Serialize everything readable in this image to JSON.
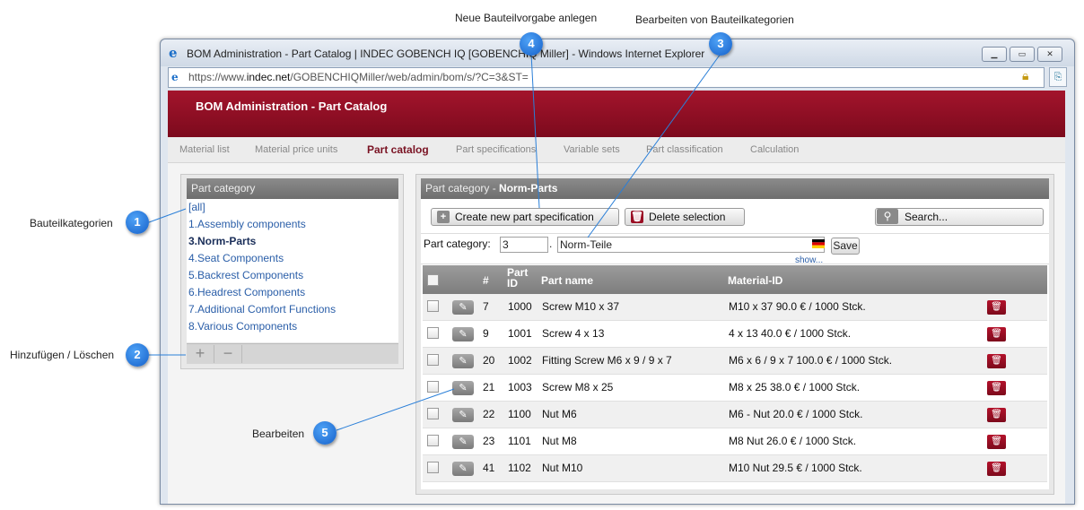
{
  "browser": {
    "window_title": "BOM Administration - Part Catalog | INDEC GOBENCH IQ [GOBENCHIQ Miller] - Windows Internet Explorer",
    "url_prefix": "https://www.",
    "url_domain": "indec.net",
    "url_path": "/GOBENCHIQMiller/web/admin/bom/s/?C=3&ST=",
    "ie_icon": "internet-explorer-icon",
    "lock_icon": "lock-icon"
  },
  "app": {
    "banner_title": "BOM Administration - Part Catalog",
    "nav": [
      {
        "label": "Material list"
      },
      {
        "label": "Material price units"
      },
      {
        "label": "Part catalog"
      },
      {
        "label": "Part specifications"
      },
      {
        "label": "Variable sets"
      },
      {
        "label": "Part classification"
      },
      {
        "label": "Calculation"
      }
    ],
    "active_nav": "Part catalog"
  },
  "left_panel": {
    "title": "Part category",
    "items": [
      {
        "label": "[all]"
      },
      {
        "label": "1.Assembly components"
      },
      {
        "label": "3.Norm-Parts"
      },
      {
        "label": "4.Seat Components"
      },
      {
        "label": "5.Backrest Components"
      },
      {
        "label": "6.Headrest Components"
      },
      {
        "label": "7.Additional Comfort Functions"
      },
      {
        "label": "8.Various Components"
      }
    ],
    "selected": "3.Norm-Parts",
    "add_label": "+",
    "remove_label": "−"
  },
  "right_panel": {
    "title_prefix": "Part category - ",
    "title_bold": "Norm-Parts",
    "create_button": "Create new part specification",
    "delete_button": "Delete selection",
    "search_placeholder": "Search...",
    "category_label": "Part category:",
    "category_id": "3",
    "category_sep": ".",
    "category_name": "Norm-Teile",
    "save_button": "Save",
    "show_link": "show...",
    "table": {
      "headers": [
        "#",
        "Part ID",
        "Part name",
        "Material-ID"
      ],
      "header_part_id_line1": "Part",
      "header_part_id_line2": "ID",
      "rows": [
        {
          "num": "7",
          "part_id": "1000",
          "name": "Screw M10 x 37",
          "material": "M10 x 37 90.0 € / 1000 Stck."
        },
        {
          "num": "9",
          "part_id": "1001",
          "name": "Screw 4 x 13",
          "material": "4 x 13 40.0 € / 1000 Stck."
        },
        {
          "num": "20",
          "part_id": "1002",
          "name": "Fitting Screw M6 x 9 / 9 x 7",
          "material": "M6 x 6 / 9 x 7 100.0 € / 1000 Stck."
        },
        {
          "num": "21",
          "part_id": "1003",
          "name": "Screw M8 x 25",
          "material": "M8 x 25 38.0 € / 1000 Stck."
        },
        {
          "num": "22",
          "part_id": "1100",
          "name": "Nut M6",
          "material": "M6 - Nut 20.0 € / 1000 Stck."
        },
        {
          "num": "23",
          "part_id": "1101",
          "name": "Nut M8",
          "material": "M8 Nut 26.0 € / 1000 Stck."
        },
        {
          "num": "41",
          "part_id": "1102",
          "name": "Nut M10",
          "material": "M10 Nut 29.5 € / 1000 Stck."
        }
      ]
    }
  },
  "callouts": [
    {
      "number": "1",
      "label": "Bauteilkategorien"
    },
    {
      "number": "2",
      "label": "Hinzufügen / Löschen"
    },
    {
      "number": "3",
      "label": "Bearbeiten von Bauteilkategorien"
    },
    {
      "number": "4",
      "label": "Neue Bauteilvorgabe anlegen"
    },
    {
      "number": "5",
      "label": "Bearbeiten"
    }
  ],
  "colors": {
    "banner": "#8f0f25",
    "callout": "#1f6fd8",
    "link": "#2a5ea8",
    "delete": "#9a0e24"
  }
}
